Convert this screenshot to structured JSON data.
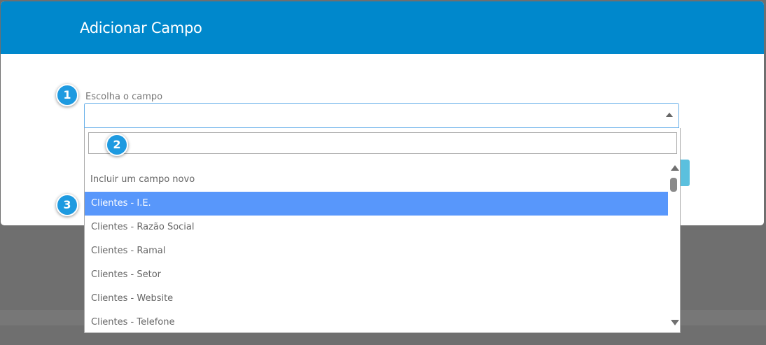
{
  "modal": {
    "title": "Adicionar Campo",
    "field_label": "Escolha o campo"
  },
  "select": {
    "value": "",
    "search_value": ""
  },
  "dropdown": {
    "options": [
      {
        "label": "Incluir um campo novo",
        "highlighted": false
      },
      {
        "label": "Clientes - I.E.",
        "highlighted": true
      },
      {
        "label": "Clientes - Razão Social",
        "highlighted": false
      },
      {
        "label": "Clientes - Ramal",
        "highlighted": false
      },
      {
        "label": "Clientes - Setor",
        "highlighted": false
      },
      {
        "label": "Clientes - Website",
        "highlighted": false
      },
      {
        "label": "Clientes - Telefone",
        "highlighted": false
      }
    ]
  },
  "callouts": [
    "1",
    "2",
    "3"
  ],
  "colors": {
    "header": "#0088cc",
    "highlight": "#5897fb",
    "badge": "#1e9ae0",
    "overlay": "#6f6f6f"
  }
}
